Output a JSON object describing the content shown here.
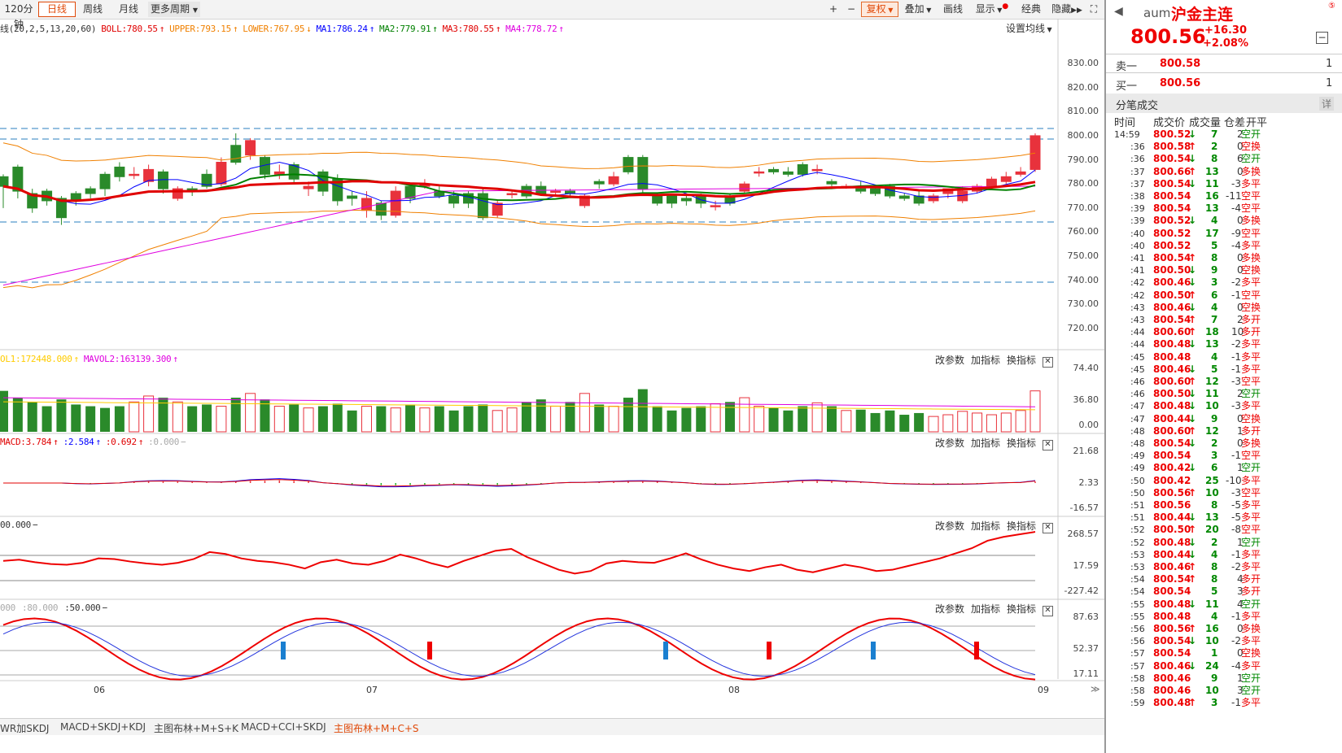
{
  "toolbar": {
    "period_label": "120分钟",
    "daily": "日线",
    "weekly": "周线",
    "monthly": "月线",
    "more_periods": "更多周期",
    "plus": "+",
    "minus": "−",
    "fuquan": "复权",
    "diejia": "叠加",
    "huaxian": "画线",
    "xianshi": "显示",
    "jingdian": "经典",
    "yincang": "隐藏"
  },
  "main_indicator": {
    "params": "线(20,2,5,13,20,60)",
    "items": [
      {
        "label": "BOLL:780.55",
        "arrow": "↑",
        "color": "#e00000"
      },
      {
        "label": "UPPER:793.15",
        "arrow": "↑",
        "color": "#f08000"
      },
      {
        "label": "LOWER:767.95",
        "arrow": "↓",
        "color": "#f08000"
      },
      {
        "label": "MA1:786.24",
        "arrow": "↑",
        "color": "#0000ff"
      },
      {
        "label": "MA2:779.91",
        "arrow": "↑",
        "color": "#008000"
      },
      {
        "label": "MA3:780.55",
        "arrow": "↑",
        "color": "#e00000"
      },
      {
        "label": "MA4:778.72",
        "arrow": "↑",
        "color": "#e000e0"
      }
    ],
    "settings": "设置均线"
  },
  "price_axis": [
    "830.00",
    "820.00",
    "810.00",
    "800.00",
    "790.00",
    "780.00",
    "770.00",
    "760.00",
    "750.00",
    "740.00",
    "730.00",
    "720.00"
  ],
  "vol_indicator": {
    "items": [
      {
        "label": "OL1:172448.000",
        "arrow": "↑",
        "color": "#ffcc00"
      },
      {
        "label": "MAVOL2:163139.300",
        "arrow": "↑",
        "color": "#e000e0"
      }
    ]
  },
  "vol_axis": [
    "74.40",
    "36.80",
    "0.00"
  ],
  "macd_indicator": {
    "items": [
      {
        "label": "MACD:3.784",
        "arrow": "↑",
        "color": "#e00000"
      },
      {
        "label": ":2.584",
        "arrow": "↑",
        "color": "#0000ff"
      },
      {
        "label": ":0.692",
        "arrow": "↑",
        "color": "#e00000"
      },
      {
        "label": ":0.000",
        "arrow": "−",
        "color": "#aaaaaa"
      }
    ]
  },
  "macd_axis": [
    "21.68",
    "2.33",
    "-16.57"
  ],
  "cci_indicator": {
    "items": [
      {
        "label": "00.000",
        "arrow": "−",
        "color": "#333333"
      }
    ]
  },
  "cci_axis": [
    "268.57",
    "17.59",
    "-227.42"
  ],
  "kdj_indicator": {
    "items": [
      {
        "label": "000",
        "arrow": "",
        "color": "#aaaaaa"
      },
      {
        "label": ":80.000",
        "arrow": "",
        "color": "#aaaaaa"
      },
      {
        "label": ":50.000",
        "arrow": "−",
        "color": "#333333"
      }
    ]
  },
  "kdj_axis": [
    "87.63",
    "52.37",
    "17.11"
  ],
  "panel_controls": {
    "modify": "改参数",
    "add": "加指标",
    "swap": "换指标",
    "close": "✕"
  },
  "date_axis": [
    "06",
    "07",
    "08",
    "09"
  ],
  "bottom_tabs": [
    "WR加SKDJ",
    "MACD+SKDJ+KDJ",
    "主图布林+M+S+K",
    "MACD+CCI+SKDJ",
    "主图布林+M+C+S"
  ],
  "quote": {
    "code": "aum",
    "name": "沪金主连",
    "price": "800.56",
    "change": "+16.30",
    "change_pct": "+2.08%",
    "sell_label": "卖一",
    "sell_price": "800.58",
    "sell_qty": "1",
    "buy_label": "买一",
    "buy_price": "800.56",
    "buy_qty": "1",
    "ticks_title": "分笔成交",
    "detail": "详",
    "headers": [
      "时间",
      "成交价",
      "成交量",
      "仓差",
      "开平"
    ]
  },
  "ticks": [
    [
      "14:59",
      "800.52",
      "↓",
      "7",
      "2",
      "空开",
      "up"
    ],
    [
      ":36",
      "800.58",
      "↑",
      "2",
      "0",
      "空换",
      "up"
    ],
    [
      ":36",
      "800.54",
      "↓",
      "8",
      "6",
      "空开",
      "up"
    ],
    [
      ":37",
      "800.66",
      "↑",
      "13",
      "0",
      "多换",
      "up"
    ],
    [
      ":37",
      "800.54",
      "↓",
      "11",
      "-3",
      "多平",
      "up"
    ],
    [
      ":38",
      "800.54",
      "",
      "16",
      "-11",
      "空平",
      "up"
    ],
    [
      ":39",
      "800.54",
      "",
      "13",
      "-4",
      "空平",
      "up"
    ],
    [
      ":39",
      "800.52",
      "↓",
      "4",
      "0",
      "多换",
      "up"
    ],
    [
      ":40",
      "800.52",
      "",
      "17",
      "-9",
      "空平",
      "up"
    ],
    [
      ":40",
      "800.52",
      "",
      "5",
      "-4",
      "多平",
      "up"
    ],
    [
      ":41",
      "800.54",
      "↑",
      "8",
      "0",
      "多换",
      "up"
    ],
    [
      ":41",
      "800.50",
      "↓",
      "9",
      "0",
      "空换",
      "up"
    ],
    [
      ":42",
      "800.46",
      "↓",
      "3",
      "-2",
      "多平",
      "up"
    ],
    [
      ":42",
      "800.50",
      "↑",
      "6",
      "-1",
      "空平",
      "up"
    ],
    [
      ":43",
      "800.46",
      "↓",
      "4",
      "0",
      "空换",
      "up"
    ],
    [
      ":43",
      "800.54",
      "↑",
      "7",
      "2",
      "多开",
      "up"
    ],
    [
      ":44",
      "800.60",
      "↑",
      "18",
      "10",
      "多开",
      "up"
    ],
    [
      ":44",
      "800.48",
      "↓",
      "13",
      "-2",
      "多平",
      "up"
    ],
    [
      ":45",
      "800.48",
      "",
      "4",
      "-1",
      "多平",
      "up"
    ],
    [
      ":45",
      "800.46",
      "↓",
      "5",
      "-1",
      "多平",
      "up"
    ],
    [
      ":46",
      "800.60",
      "↑",
      "12",
      "-3",
      "空平",
      "up"
    ],
    [
      ":46",
      "800.50",
      "↓",
      "11",
      "2",
      "空开",
      "up"
    ],
    [
      ":47",
      "800.48",
      "↓",
      "10",
      "-3",
      "多平",
      "up"
    ],
    [
      ":47",
      "800.44",
      "↓",
      "9",
      "0",
      "空换",
      "up"
    ],
    [
      ":48",
      "800.60",
      "↑",
      "12",
      "1",
      "多开",
      "up"
    ],
    [
      ":48",
      "800.54",
      "↓",
      "2",
      "0",
      "多换",
      "up"
    ],
    [
      ":49",
      "800.54",
      "",
      "3",
      "-1",
      "空平",
      "up"
    ],
    [
      ":49",
      "800.42",
      "↓",
      "6",
      "1",
      "空开",
      "up"
    ],
    [
      ":50",
      "800.42",
      "",
      "25",
      "-10",
      "多平",
      "up"
    ],
    [
      ":50",
      "800.56",
      "↑",
      "10",
      "-3",
      "空平",
      "up"
    ],
    [
      ":51",
      "800.56",
      "",
      "8",
      "-5",
      "多平",
      "up"
    ],
    [
      ":51",
      "800.44",
      "↓",
      "13",
      "-5",
      "多平",
      "up"
    ],
    [
      ":52",
      "800.50",
      "↑",
      "20",
      "-8",
      "空平",
      "up"
    ],
    [
      ":52",
      "800.48",
      "↓",
      "2",
      "1",
      "空开",
      "up"
    ],
    [
      ":53",
      "800.44",
      "↓",
      "4",
      "-1",
      "多平",
      "up"
    ],
    [
      ":53",
      "800.46",
      "↑",
      "8",
      "-2",
      "多平",
      "up"
    ],
    [
      ":54",
      "800.54",
      "↑",
      "8",
      "4",
      "多开",
      "up"
    ],
    [
      ":54",
      "800.54",
      "",
      "5",
      "3",
      "多开",
      "up"
    ],
    [
      ":55",
      "800.48",
      "↓",
      "11",
      "4",
      "空开",
      "up"
    ],
    [
      ":55",
      "800.48",
      "",
      "4",
      "-1",
      "多平",
      "up"
    ],
    [
      ":56",
      "800.56",
      "↑",
      "16",
      "0",
      "多换",
      "up"
    ],
    [
      ":56",
      "800.54",
      "↓",
      "10",
      "-2",
      "多平",
      "up"
    ],
    [
      ":57",
      "800.54",
      "",
      "1",
      "0",
      "空换",
      "up"
    ],
    [
      ":57",
      "800.46",
      "↓",
      "24",
      "-4",
      "多平",
      "up"
    ],
    [
      ":58",
      "800.46",
      "",
      "9",
      "1",
      "空开",
      "up"
    ],
    [
      ":58",
      "800.46",
      "",
      "10",
      "3",
      "空开",
      "up"
    ],
    [
      ":59",
      "800.48",
      "↑",
      "3",
      "-1",
      "多平",
      "up"
    ]
  ],
  "colors": {
    "up": "#e8323c",
    "down": "#2a8a2a",
    "boll": "#f08000",
    "ma1": "#0000ff",
    "ma2": "#008000",
    "ma3": "#e00000",
    "ma4": "#e000e0",
    "grid_dash": "#2a7fbf"
  }
}
